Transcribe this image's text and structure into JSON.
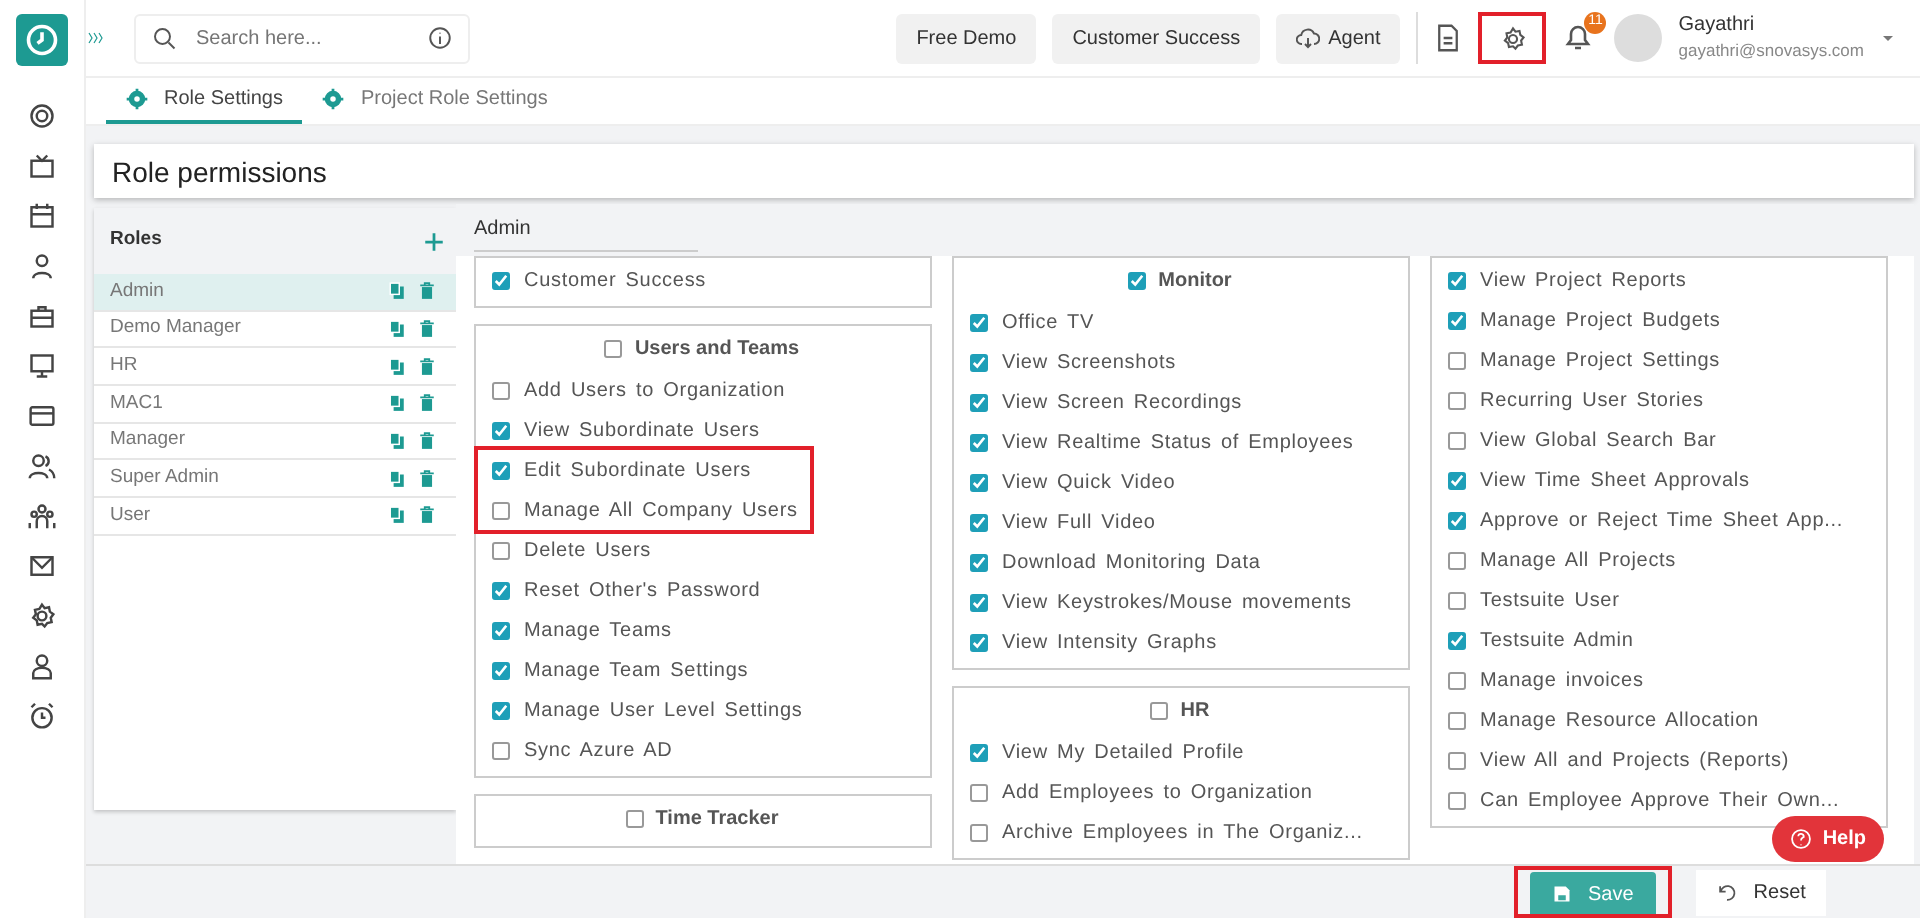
{
  "topbar": {
    "search": {
      "placeholder": "Search here..."
    },
    "buttons": [
      {
        "label": "Free Demo",
        "kind": "plain"
      },
      {
        "label": "Customer Success",
        "kind": "plain"
      },
      {
        "label": "Agent",
        "kind": "cloud"
      }
    ],
    "settings_highlighted": true,
    "notification_count": "11",
    "user": {
      "name": "Gayathri",
      "email": "gayathri@snovasys.com"
    }
  },
  "tabs": [
    {
      "label": "Role Settings",
      "selected": true
    },
    {
      "label": "Project Role Settings",
      "selected": false
    }
  ],
  "page_title": "Role permissions",
  "roles": {
    "title": "Roles",
    "items": [
      {
        "name": "Admin",
        "selected": true
      },
      {
        "name": "Demo Manager",
        "selected": false
      },
      {
        "name": "HR",
        "selected": false
      },
      {
        "name": "MAC1",
        "selected": false
      },
      {
        "name": "Manager",
        "selected": false
      },
      {
        "name": "Super Admin",
        "selected": false
      },
      {
        "name": "User",
        "selected": false
      }
    ]
  },
  "selected_role": "Admin",
  "permission_columns": [
    [
      {
        "items": [
          {
            "label": "Customer Success",
            "checked": true,
            "highlighted": false
          }
        ]
      },
      {
        "title": "Users and Teams",
        "checked": false,
        "items": [
          {
            "label": "Add Users to Organization",
            "checked": false,
            "highlighted": false
          },
          {
            "label": "View Subordinate Users",
            "checked": true,
            "highlighted": false
          },
          {
            "label": "Edit Subordinate Users",
            "checked": true,
            "highlighted": true
          },
          {
            "label": "Manage All Company Users",
            "checked": false,
            "highlighted": true
          },
          {
            "label": "Delete Users",
            "checked": false,
            "highlighted": false
          },
          {
            "label": "Reset Other's Password",
            "checked": true,
            "highlighted": false
          },
          {
            "label": "Manage Teams",
            "checked": true,
            "highlighted": false
          },
          {
            "label": "Manage Team Settings",
            "checked": true,
            "highlighted": false
          },
          {
            "label": "Manage User Level Settings",
            "checked": true,
            "highlighted": false
          },
          {
            "label": "Sync Azure AD",
            "checked": false,
            "highlighted": false
          }
        ]
      },
      {
        "title": "Time Tracker",
        "checked": false
      }
    ],
    [
      {
        "title": "Monitor",
        "checked": true,
        "items": [
          {
            "label": "Office TV",
            "checked": true,
            "highlighted": false
          },
          {
            "label": "View Screenshots",
            "checked": true,
            "highlighted": false
          },
          {
            "label": "View Screen Recordings",
            "checked": true,
            "highlighted": false
          },
          {
            "label": "View Realtime Status of Employees",
            "checked": true,
            "highlighted": false
          },
          {
            "label": "View Quick Video",
            "checked": true,
            "highlighted": false
          },
          {
            "label": "View Full Video",
            "checked": true,
            "highlighted": false
          },
          {
            "label": "Download Monitoring Data",
            "checked": true,
            "highlighted": false
          },
          {
            "label": "View Keystrokes/Mouse movements",
            "checked": true,
            "highlighted": false
          },
          {
            "label": "View Intensity Graphs",
            "checked": true,
            "highlighted": false
          }
        ]
      },
      {
        "title": "HR",
        "checked": false,
        "items": [
          {
            "label": "View My Detailed Profile",
            "checked": true,
            "highlighted": false
          },
          {
            "label": "Add Employees to Organization",
            "checked": false,
            "highlighted": false
          },
          {
            "label": "Archive Employees in The Organiz...",
            "checked": false,
            "highlighted": false
          }
        ]
      }
    ],
    [
      {
        "items": [
          {
            "label": "View Project Reports",
            "checked": true,
            "highlighted": false
          },
          {
            "label": "Manage Project Budgets",
            "checked": true,
            "highlighted": false
          },
          {
            "label": "Manage Project Settings",
            "checked": false,
            "highlighted": false
          },
          {
            "label": "Recurring User Stories",
            "checked": false,
            "highlighted": false
          },
          {
            "label": "View Global Search Bar",
            "checked": false,
            "highlighted": false
          },
          {
            "label": "View Time Sheet Approvals",
            "checked": true,
            "highlighted": false
          },
          {
            "label": "Approve or Reject Time Sheet App...",
            "checked": true,
            "highlighted": false
          },
          {
            "label": "Manage All Projects",
            "checked": false,
            "highlighted": false
          },
          {
            "label": "Testsuite User",
            "checked": false,
            "highlighted": false
          },
          {
            "label": "Testsuite Admin",
            "checked": true,
            "highlighted": false
          },
          {
            "label": "Manage invoices",
            "checked": false,
            "highlighted": false
          },
          {
            "label": "Manage Resource Allocation",
            "checked": false,
            "highlighted": false
          },
          {
            "label": "View All and Projects (Reports)",
            "checked": false,
            "highlighted": false
          },
          {
            "label": "Can Employee Approve Their Own...",
            "checked": false,
            "highlighted": false
          }
        ]
      }
    ]
  ],
  "footer": {
    "save": {
      "label": "Save",
      "highlighted": true
    },
    "reset": "Reset",
    "help": "Help"
  }
}
